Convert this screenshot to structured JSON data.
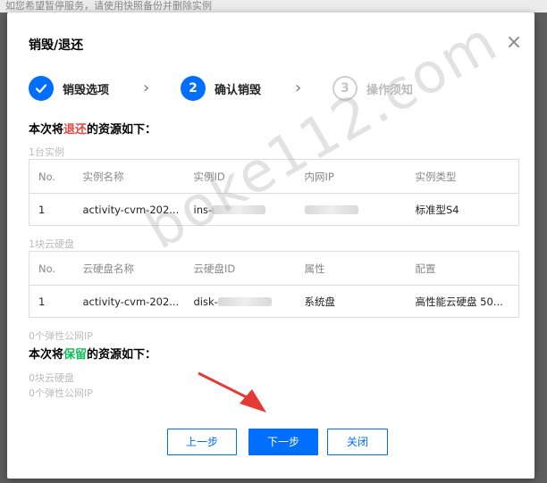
{
  "backdrop": {
    "text": "如您希望暂停服务，请使用快照备份并删除实例"
  },
  "dialog": {
    "title": "销毁/退还",
    "close_label": "×"
  },
  "steps": [
    {
      "num": "✓",
      "label": "销毁选项",
      "state": "done"
    },
    {
      "num": "2",
      "label": "确认销毁",
      "state": "active"
    },
    {
      "num": "3",
      "label": "操作须知",
      "state": "todo"
    }
  ],
  "section_return": {
    "prefix": "本次将",
    "keyword": "退还",
    "suffix": "的资源如下："
  },
  "instances": {
    "count_label": "1台实例",
    "headers": [
      "No.",
      "实例名称",
      "实例ID",
      "内网IP",
      "实例类型"
    ],
    "rows": [
      {
        "no": "1",
        "name": "activity-cvm-202...",
        "id": "ins-",
        "ip": "",
        "type": "标准型S4"
      }
    ]
  },
  "disks": {
    "count_label": "1块云硬盘",
    "headers": [
      "No.",
      "云硬盘名称",
      "云硬盘ID",
      "属性",
      "配置"
    ],
    "rows": [
      {
        "no": "1",
        "name": "activity-cvm-202...",
        "id": "disk-",
        "attr": "系统盘",
        "config": "高性能云硬盘 50..."
      }
    ]
  },
  "eip_return_label": "0个弹性公网IP",
  "section_keep": {
    "prefix": "本次将",
    "keyword": "保留",
    "suffix": "的资源如下："
  },
  "keep_disks_label": "0块云硬盘",
  "keep_eip_label": "0个弹性公网IP",
  "buttons": {
    "prev": "上一步",
    "next": "下一步",
    "close": "关闭"
  },
  "watermark": "boke112.com",
  "colors": {
    "primary": "#006eff",
    "return": "#e54545",
    "keep": "#0abf5b",
    "arrow": "#e53935"
  }
}
